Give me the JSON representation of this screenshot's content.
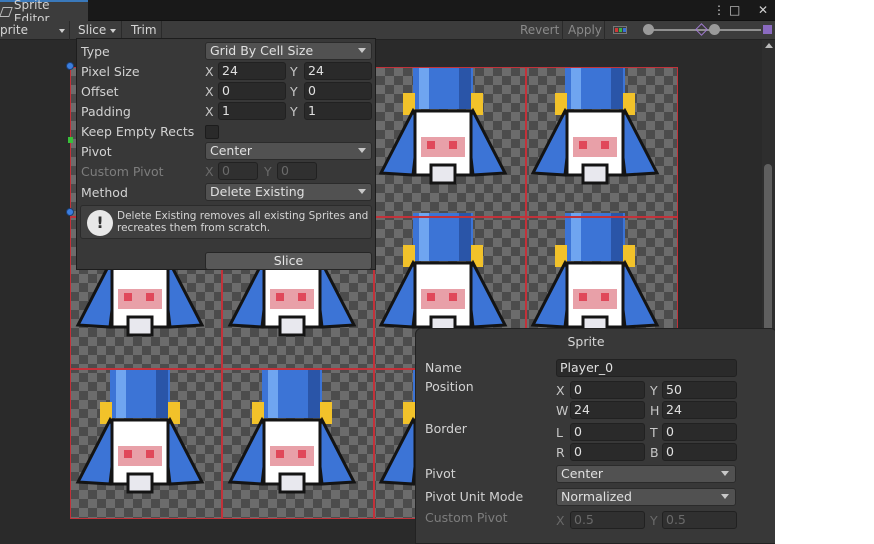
{
  "window": {
    "tab_title": "Sprite Editor",
    "controls": {
      "more": "⋮",
      "maximize": "□",
      "close": "✕"
    }
  },
  "toolbar": {
    "mode_label": "prite Editor",
    "slice_label": "Slice",
    "trim_label": "Trim",
    "revert_label": "Revert",
    "apply_label": "Apply"
  },
  "slice_panel": {
    "type_label": "Type",
    "type_value": "Grid By Cell Size",
    "pixel_size_label": "Pixel Size",
    "pixel_size": {
      "x": "24",
      "y": "24"
    },
    "offset_label": "Offset",
    "offset": {
      "x": "0",
      "y": "0"
    },
    "padding_label": "Padding",
    "padding": {
      "x": "1",
      "y": "1"
    },
    "keep_empty_label": "Keep Empty Rects",
    "keep_empty_checked": false,
    "pivot_label": "Pivot",
    "pivot_value": "Center",
    "custom_pivot_label": "Custom Pivot",
    "custom_pivot": {
      "x": "0",
      "y": "0"
    },
    "method_label": "Method",
    "method_value": "Delete Existing",
    "help_text": "Delete Existing removes all existing Sprites and recreates them from scratch.",
    "slice_button": "Slice",
    "axis_x": "X",
    "axis_y": "Y"
  },
  "sprite_panel": {
    "title": "Sprite",
    "name_label": "Name",
    "name_value": "Player_0",
    "position_label": "Position",
    "position": {
      "x": "0",
      "y": "50",
      "w": "24",
      "h": "24"
    },
    "border_label": "Border",
    "border": {
      "l": "0",
      "t": "0",
      "r": "0",
      "b": "0"
    },
    "pivot_label": "Pivot",
    "pivot_value": "Center",
    "pivot_unit_label": "Pivot Unit Mode",
    "pivot_unit_value": "Normalized",
    "custom_pivot_label": "Custom Pivot",
    "custom_pivot": {
      "x": "0.5",
      "y": "0.5"
    },
    "axis": {
      "x": "X",
      "y": "Y",
      "w": "W",
      "h": "H",
      "l": "L",
      "t": "T",
      "r": "R",
      "b": "B"
    }
  },
  "icons": {
    "tab": "sprite-editor-icon",
    "color_channel": "rgb-channels-icon",
    "zoom_min": "small-mountain-icon",
    "zoom_max": "large-mountain-icon",
    "help": "info-icon"
  },
  "colors": {
    "accent_blue": "#3a79bb",
    "cell_outline": "#c2323a",
    "handle": "#3b7ede",
    "sprite_blue": "#3c74d6",
    "sprite_gold": "#f2c22a"
  }
}
